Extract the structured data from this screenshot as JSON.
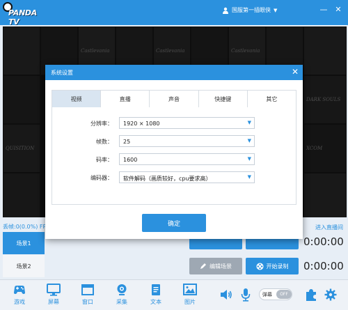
{
  "titlebar": {
    "logo_text": "PANDA TV",
    "username": "国服第一插眼侠",
    "caret": "▼",
    "min_glyph": "—",
    "close_glyph": "✕"
  },
  "preview": {
    "tile_titles": [
      "Castlevania",
      "Castlevania",
      "Castlevania",
      "XCOM",
      "DARK SOULS",
      "QUISITION"
    ]
  },
  "status": {
    "text": "丢帧:0(0.0%) FP"
  },
  "scenes": {
    "scene1": "场景1",
    "scene2": "场景2"
  },
  "right": {
    "enter_live": "进入直播间",
    "edit_scene": "编辑场景",
    "start_record": "开始录制",
    "timer1": "0:00:00",
    "timer2": "0:00:00"
  },
  "toolbar": {
    "tools": [
      "游戏",
      "屏幕",
      "窗口",
      "采集",
      "文本",
      "图片"
    ],
    "barrage_label": "弹幕",
    "barrage_state": "OFF"
  },
  "dialog": {
    "title": "系统设置",
    "close_glyph": "✕",
    "tabs": [
      "视频",
      "直播",
      "声音",
      "快捷键",
      "其它"
    ],
    "active_tab": "视频",
    "fields": [
      {
        "label": "分辨率：",
        "value": "1920 × 1080"
      },
      {
        "label": "帧数：",
        "value": "25"
      },
      {
        "label": "码率：",
        "value": "1600"
      },
      {
        "label": "编码器：",
        "value": "软件解码（画质较好，cpu要求高）"
      }
    ],
    "confirm_label": "确定"
  },
  "colors": {
    "accent": "#2b91de",
    "active_tab_bg": "#d9e5f1",
    "grey_button": "#9ea8b3"
  }
}
